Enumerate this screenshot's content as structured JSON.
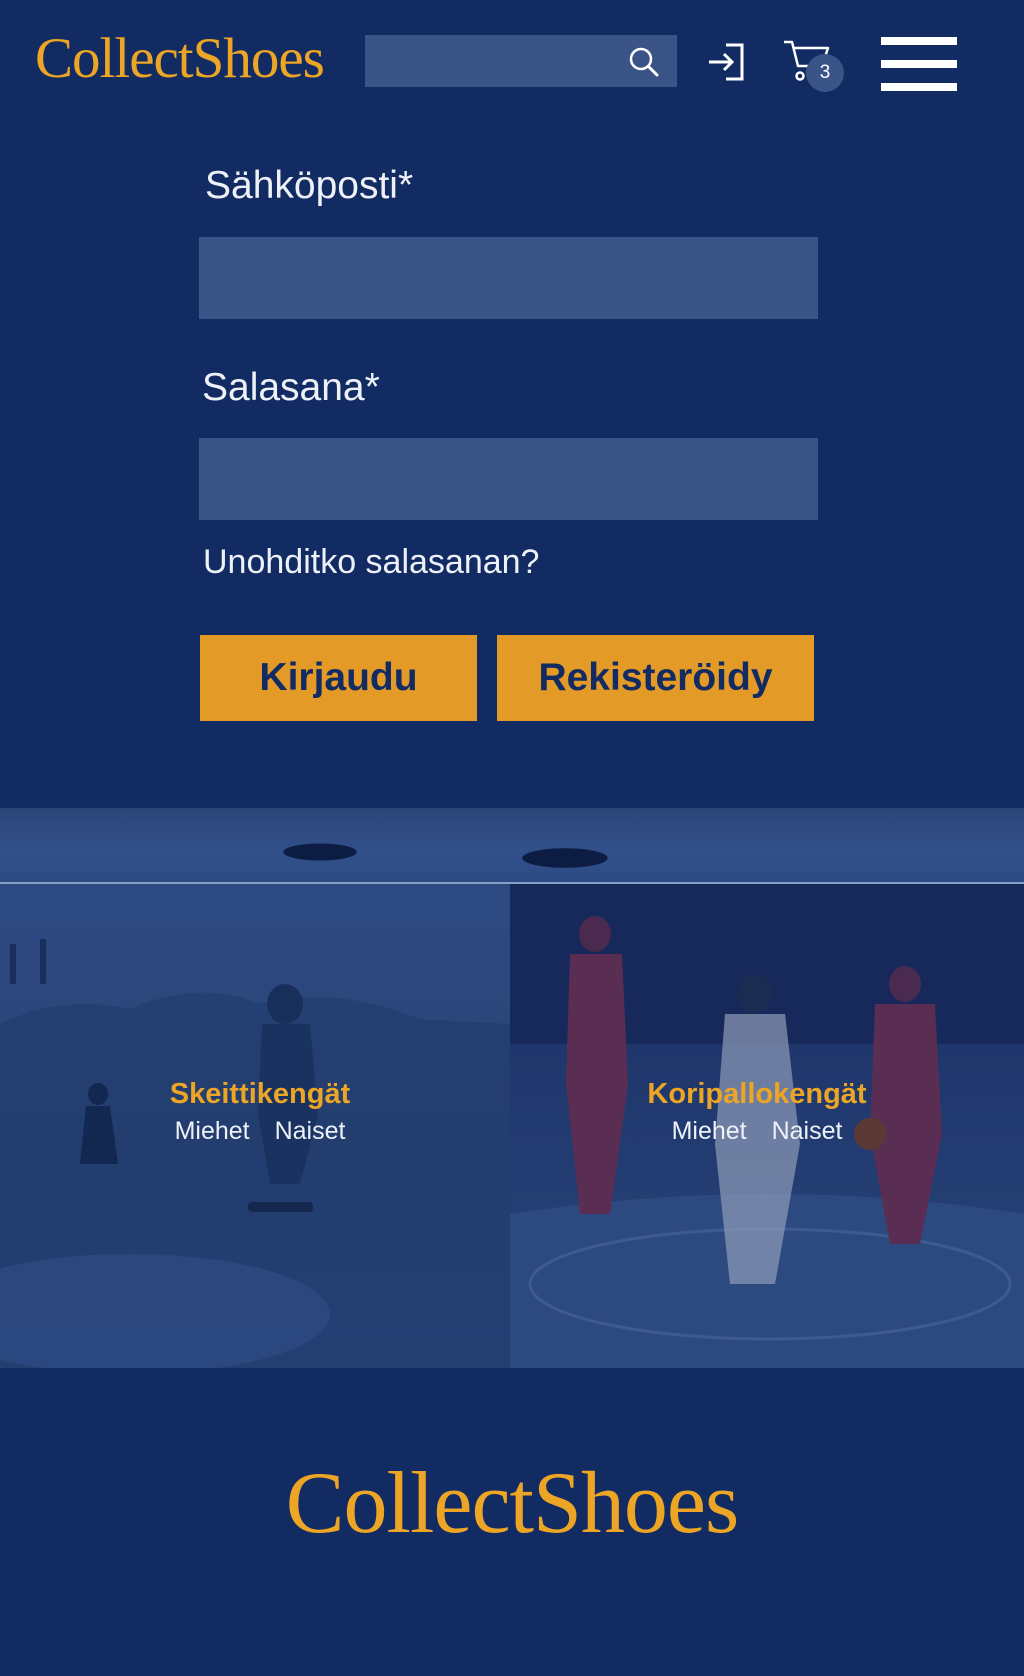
{
  "header": {
    "logo": "CollectShoes",
    "search": {
      "placeholder": "",
      "value": ""
    },
    "cart_count": "3"
  },
  "login_form": {
    "email_label": "Sähköposti*",
    "password_label": "Salasana*",
    "forgot_link": "Unohditko salasanan?",
    "login_button": "Kirjaudu",
    "register_button": "Rekisteröidy"
  },
  "categories": [
    {
      "title": "Skeittikengät",
      "links": [
        "Miehet",
        "Naiset"
      ]
    },
    {
      "title": "Koripallokengät",
      "links": [
        "Miehet",
        "Naiset"
      ]
    }
  ],
  "footer": {
    "logo": "CollectShoes"
  },
  "colors": {
    "background": "#122c63",
    "accent": "#eca524",
    "button": "#e39a27",
    "input": "#3a5487"
  }
}
